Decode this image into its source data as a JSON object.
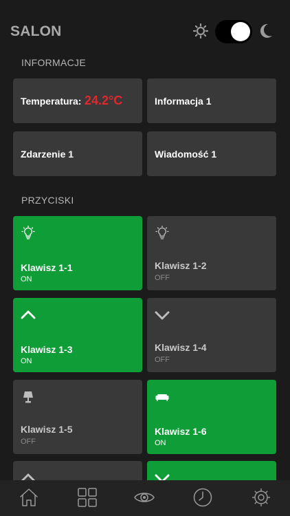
{
  "header": {
    "title": "SALON"
  },
  "sections": {
    "info_label": "INFORMACJE",
    "buttons_label": "PRZYCISKI"
  },
  "info": {
    "temperature_label": "Temperatura:",
    "temperature_value": "24.2°C",
    "info1": "Informacja 1",
    "event1": "Zdarzenie 1",
    "message1": "Wiadomość 1"
  },
  "buttons": [
    {
      "name": "Klawisz 1-1",
      "state": "ON",
      "icon": "bulb-icon"
    },
    {
      "name": "Klawisz 1-2",
      "state": "OFF",
      "icon": "bulb-icon"
    },
    {
      "name": "Klawisz 1-3",
      "state": "ON",
      "icon": "chevron-up-icon"
    },
    {
      "name": "Klawisz 1-4",
      "state": "OFF",
      "icon": "chevron-down-icon"
    },
    {
      "name": "Klawisz 1-5",
      "state": "OFF",
      "icon": "lamp-icon"
    },
    {
      "name": "Klawisz 1-6",
      "state": "ON",
      "icon": "sofa-icon"
    }
  ],
  "theme": {
    "dark_mode": true,
    "accent_on": "#0e9d36",
    "tile_off": "#393939",
    "temperature_color": "#e0282e"
  },
  "tabbar": [
    "home-icon",
    "grid-icon",
    "eye-icon",
    "clock-icon",
    "settings-gear-icon"
  ]
}
